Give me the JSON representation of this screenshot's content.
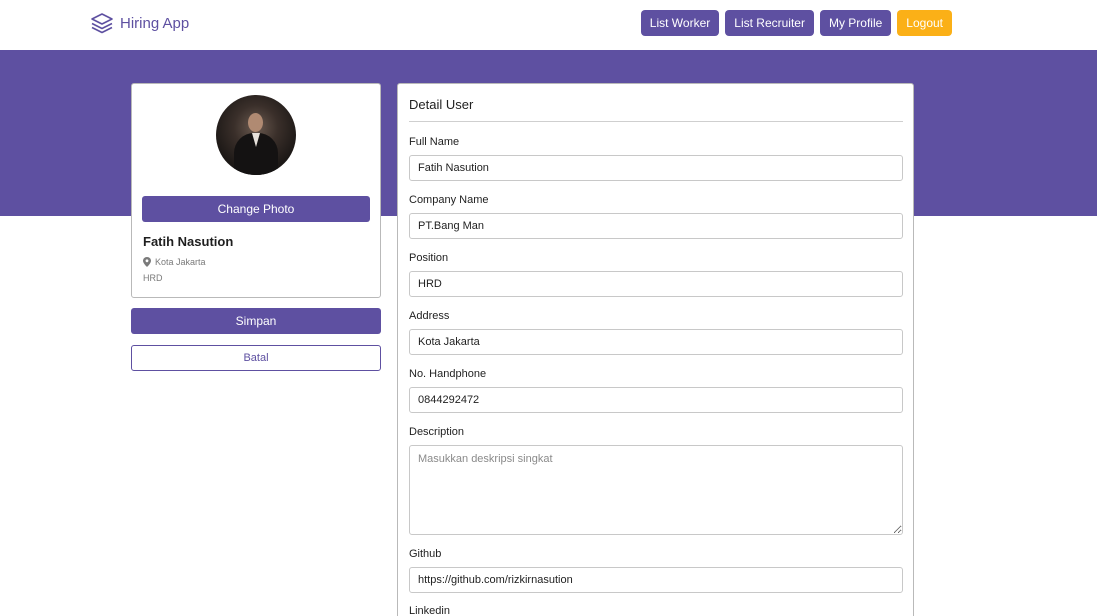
{
  "navbar": {
    "brand": "Hiring App",
    "links": [
      "List Worker",
      "List Recruiter",
      "My Profile"
    ],
    "logout": "Logout"
  },
  "colors": {
    "primary": "#5e50a1",
    "accent": "#fbb017"
  },
  "profile": {
    "change_photo": "Change Photo",
    "name": "Fatih Nasution",
    "location_icon": "map-pin-icon",
    "location": "Kota Jakarta",
    "position": "HRD"
  },
  "actions": {
    "save": "Simpan",
    "cancel": "Batal"
  },
  "detail": {
    "title": "Detail User",
    "fields": {
      "full_name": {
        "label": "Full Name",
        "value": "Fatih Nasution"
      },
      "company": {
        "label": "Company Name",
        "value": "PT.Bang Man"
      },
      "position": {
        "label": "Position",
        "value": "HRD"
      },
      "address": {
        "label": "Address",
        "value": "Kota Jakarta"
      },
      "phone": {
        "label": "No. Handphone",
        "value": "0844292472"
      },
      "description": {
        "label": "Description",
        "placeholder": "Masukkan deskripsi singkat"
      },
      "github": {
        "label": "Github",
        "value": "https://github.com/rizkirnasution"
      },
      "linkedin": {
        "label": "Linkedin"
      }
    }
  }
}
